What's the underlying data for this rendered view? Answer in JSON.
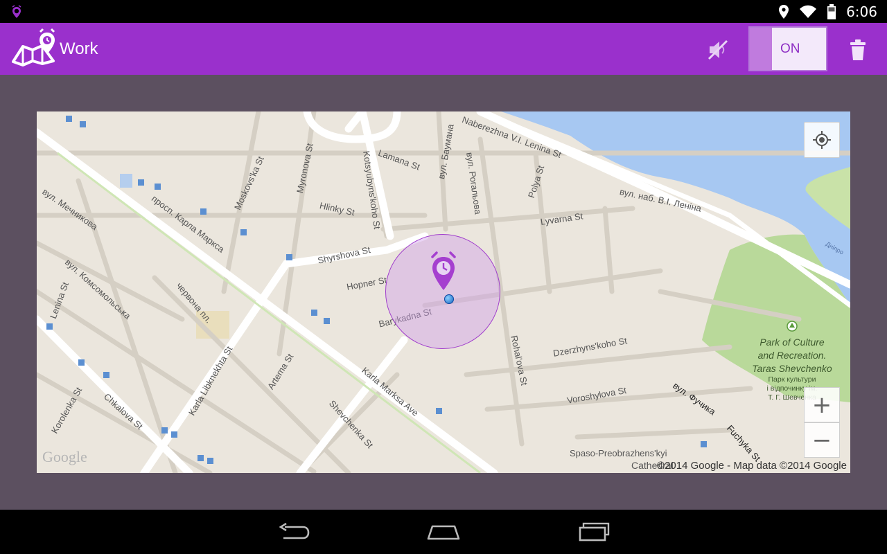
{
  "status_bar": {
    "time": "6:06",
    "left_icon": "geofence-alarm-notification-icon",
    "icons": [
      "location-icon",
      "wifi-icon",
      "battery-icon"
    ]
  },
  "action_bar": {
    "title": "Work",
    "app_icon": "map-alarm-logo-icon",
    "mute_icon": "volume-off-icon",
    "toggle_label": "ON",
    "delete_icon": "trash-icon",
    "accent": "#9a30cc"
  },
  "map": {
    "streets": [
      "Naberezhna V.I. Lenina St",
      "вул. наб. В.І. Леніна",
      "Lamana St",
      "вул. Баумана",
      "вул. Рогальова",
      "Polya St",
      "Kotsyubyns'koho St",
      "Myronova St",
      "Moskovs'ka St",
      "Hlinky St",
      "Lyvarna St",
      "вул. Мечникова",
      "просп. Карла Маркса",
      "Shyrshova St",
      "Hopner St",
      "Barykadna St",
      "вул. Комсомольська",
      "червона пл.",
      "Lenina St",
      "Karla Libknekhta St",
      "Artema St",
      "Karla Marksa Ave",
      "Shevchenka St",
      "Rohal'ova St",
      "Dzerzhyns'koho St",
      "Voroshylova St",
      "вул. Фучика",
      "Fuchyka St",
      "Korolenka St",
      "Chkalova St",
      "Spaso-Preobrazhens'kyi",
      "Дніпро"
    ],
    "park": {
      "name_lines": [
        "Park of Culture",
        "and Recreation.",
        "Taras Shevchenko"
      ],
      "local_lines": [
        "Парк культури",
        "і відпочинку ім.",
        "Т. Г. Шевченка"
      ]
    },
    "google_logo": "Google",
    "cathedral_fragment": "Cathedral",
    "attribution": "©2014 Google - Map data ©2014 Google",
    "zoom_in": "+",
    "zoom_out": "−",
    "my_location_icon": "my-location-icon",
    "alarm_pin_icon": "alarm-pin-icon",
    "geofence_color": "#a03dcc"
  },
  "nav_bar": {
    "icons": [
      "back-icon",
      "home-icon",
      "recents-icon"
    ]
  }
}
